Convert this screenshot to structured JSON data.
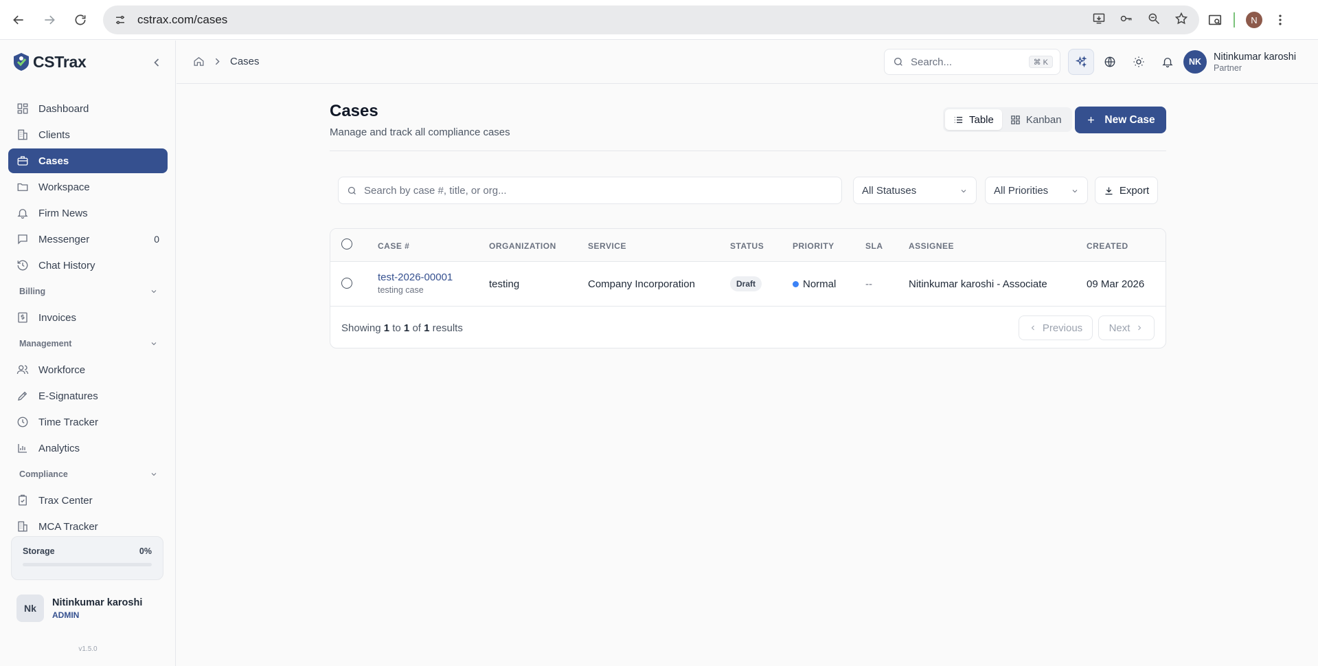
{
  "browser": {
    "url": "cstrax.com/cases",
    "profile_initial": "N"
  },
  "brand": {
    "name": "CSTrax",
    "accent": "#35508f"
  },
  "sidebar": {
    "items": [
      {
        "label": "Dashboard",
        "icon": "dashboard-icon"
      },
      {
        "label": "Clients",
        "icon": "building-icon"
      },
      {
        "label": "Cases",
        "icon": "briefcase-icon",
        "active": true
      },
      {
        "label": "Workspace",
        "icon": "folder-icon"
      },
      {
        "label": "Firm News",
        "icon": "bell-icon"
      },
      {
        "label": "Messenger",
        "icon": "message-icon",
        "count": "0"
      },
      {
        "label": "Chat History",
        "icon": "history-icon"
      }
    ],
    "billing": {
      "title": "Billing",
      "items": [
        {
          "label": "Invoices",
          "icon": "invoice-icon"
        }
      ]
    },
    "management": {
      "title": "Management",
      "items": [
        {
          "label": "Workforce",
          "icon": "users-icon"
        },
        {
          "label": "E-Signatures",
          "icon": "pen-icon"
        },
        {
          "label": "Time Tracker",
          "icon": "clock-icon"
        },
        {
          "label": "Analytics",
          "icon": "chart-icon"
        }
      ]
    },
    "compliance": {
      "title": "Compliance",
      "items": [
        {
          "label": "Trax Center",
          "icon": "clipboard-icon"
        },
        {
          "label": "MCA Tracker",
          "icon": "building-icon"
        }
      ]
    },
    "storage": {
      "label": "Storage",
      "value": "0%",
      "fraction": 0
    },
    "user": {
      "initials": "Nk",
      "name": "Nitinkumar karoshi",
      "role": "ADMIN"
    },
    "version": "v1.5.0"
  },
  "header": {
    "breadcrumb": "Cases",
    "search_placeholder": "Search...",
    "shortcut": "⌘ K",
    "profile": {
      "initials": "NK",
      "name": "Nitinkumar karoshi",
      "role": "Partner"
    }
  },
  "page": {
    "title": "Cases",
    "subtitle": "Manage and track all compliance cases",
    "view_table": "Table",
    "view_kanban": "Kanban",
    "new_case": "New Case"
  },
  "filters": {
    "search_placeholder": "Search by case #, title, or org...",
    "status": "All Statuses",
    "priority": "All Priorities",
    "export": "Export"
  },
  "table": {
    "columns": [
      "CASE #",
      "ORGANIZATION",
      "SERVICE",
      "STATUS",
      "PRIORITY",
      "SLA",
      "ASSIGNEE",
      "CREATED"
    ],
    "rows": [
      {
        "case_no": "test-2026-00001",
        "title": "testing case",
        "organization": "testing",
        "service": "Company Incorporation",
        "status": "Draft",
        "priority": "Normal",
        "priority_color": "#3b82f6",
        "sla": "--",
        "assignee": "Nitinkumar karoshi - Associate",
        "created": "09 Mar 2026"
      }
    ],
    "footer": {
      "showing": "Showing",
      "from": "1",
      "to_word": "to",
      "to": "1",
      "of_word": "of",
      "total": "1",
      "results": "results"
    },
    "prev": "Previous",
    "next": "Next"
  }
}
